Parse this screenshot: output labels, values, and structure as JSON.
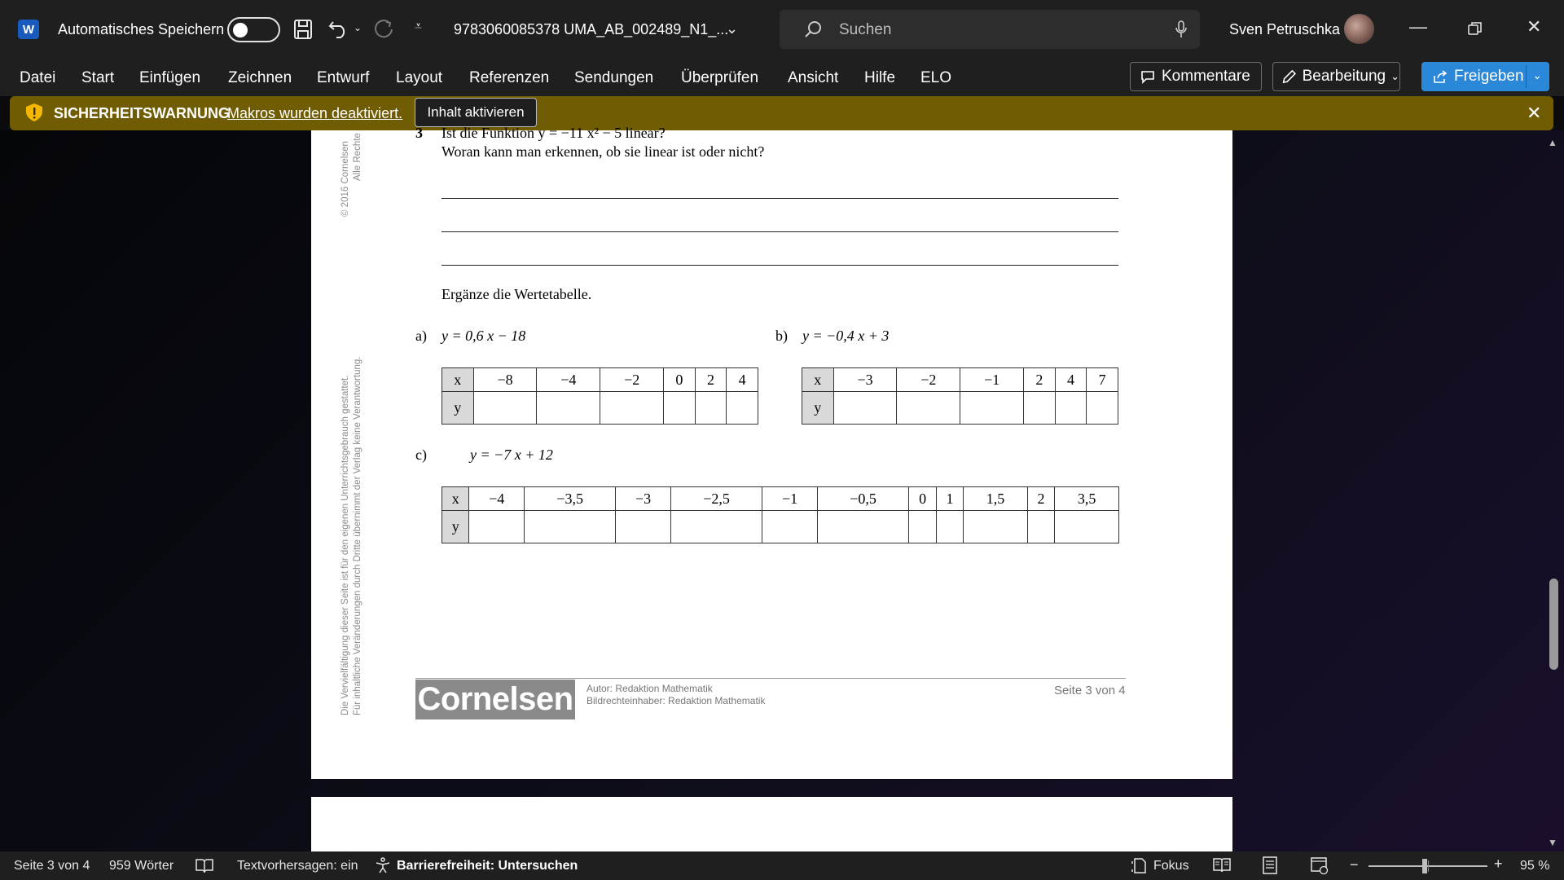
{
  "titlebar": {
    "app_icon": "word-logo-icon",
    "app_letter": "W",
    "autosave_label": "Automatisches Speichern",
    "doc_title": "9783060085378 UMA_AB_002489_N1_...",
    "search_placeholder": "Suchen",
    "user_name": "Sven Petruschka"
  },
  "menu": {
    "items": [
      "Datei",
      "Start",
      "Einfügen",
      "Zeichnen",
      "Entwurf",
      "Layout",
      "Referenzen",
      "Sendungen",
      "Überprüfen",
      "Ansicht",
      "Hilfe",
      "ELO"
    ],
    "kommentare": "Kommentare",
    "bearbeitung": "Bearbeitung",
    "freigeben": "Freigeben"
  },
  "warning": {
    "title": "SICHERHEITSWARNUNG",
    "message": "Makros wurden deaktiviert.",
    "button": "Inhalt aktivieren"
  },
  "document": {
    "task_number": "3",
    "question_line1": "Ist die Funktion y = −11 x² − 5 linear?",
    "question_line2": "Woran kann man erkennen, ob sie linear ist oder nicht?",
    "instruction": "Ergänze die Wertetabelle.",
    "part_a": {
      "label": "a)",
      "equation": "y = 0,6 x − 18",
      "x_header": "x",
      "y_header": "y",
      "x_values": [
        "−8",
        "−4",
        "−2",
        "0",
        "2",
        "4"
      ]
    },
    "part_b": {
      "label": "b)",
      "equation": "y = −0,4 x + 3",
      "x_header": "x",
      "y_header": "y",
      "x_values": [
        "−3",
        "−2",
        "−1",
        "2",
        "4",
        "7"
      ]
    },
    "part_c": {
      "label": "c)",
      "equation": "y = −7 x + 12",
      "x_header": "x",
      "y_header": "y",
      "x_values": [
        "−4",
        "−3,5",
        "−3",
        "−2,5",
        "−1",
        "−0,5",
        "0",
        "1",
        "1,5",
        "2",
        "3,5"
      ]
    },
    "side_copyright": "© 2016 Cornelsen",
    "side_rights": "Alle Rechte",
    "side_usage_line1": "Die Vervielfältigung dieser Seite ist für den eigenen Unterrichtsgebrauch gestattet.",
    "side_usage_line2": "Für inhaltliche Veränderungen durch Dritte übernimmt der Verlag keine Verantwortung.",
    "footer_logo": "Cornelsen",
    "footer_author": "Autor: Redaktion Mathematik",
    "footer_rights": "Bildrechteinhaber: Redaktion Mathematik",
    "footer_page": "Seite 3 von 4"
  },
  "status": {
    "page": "Seite 3 von 4",
    "words": "959 Wörter",
    "text_predictions": "Textvorhersagen: ein",
    "accessibility": "Barrierefreiheit: Untersuchen",
    "focus": "Fokus",
    "zoom": "95 %"
  }
}
